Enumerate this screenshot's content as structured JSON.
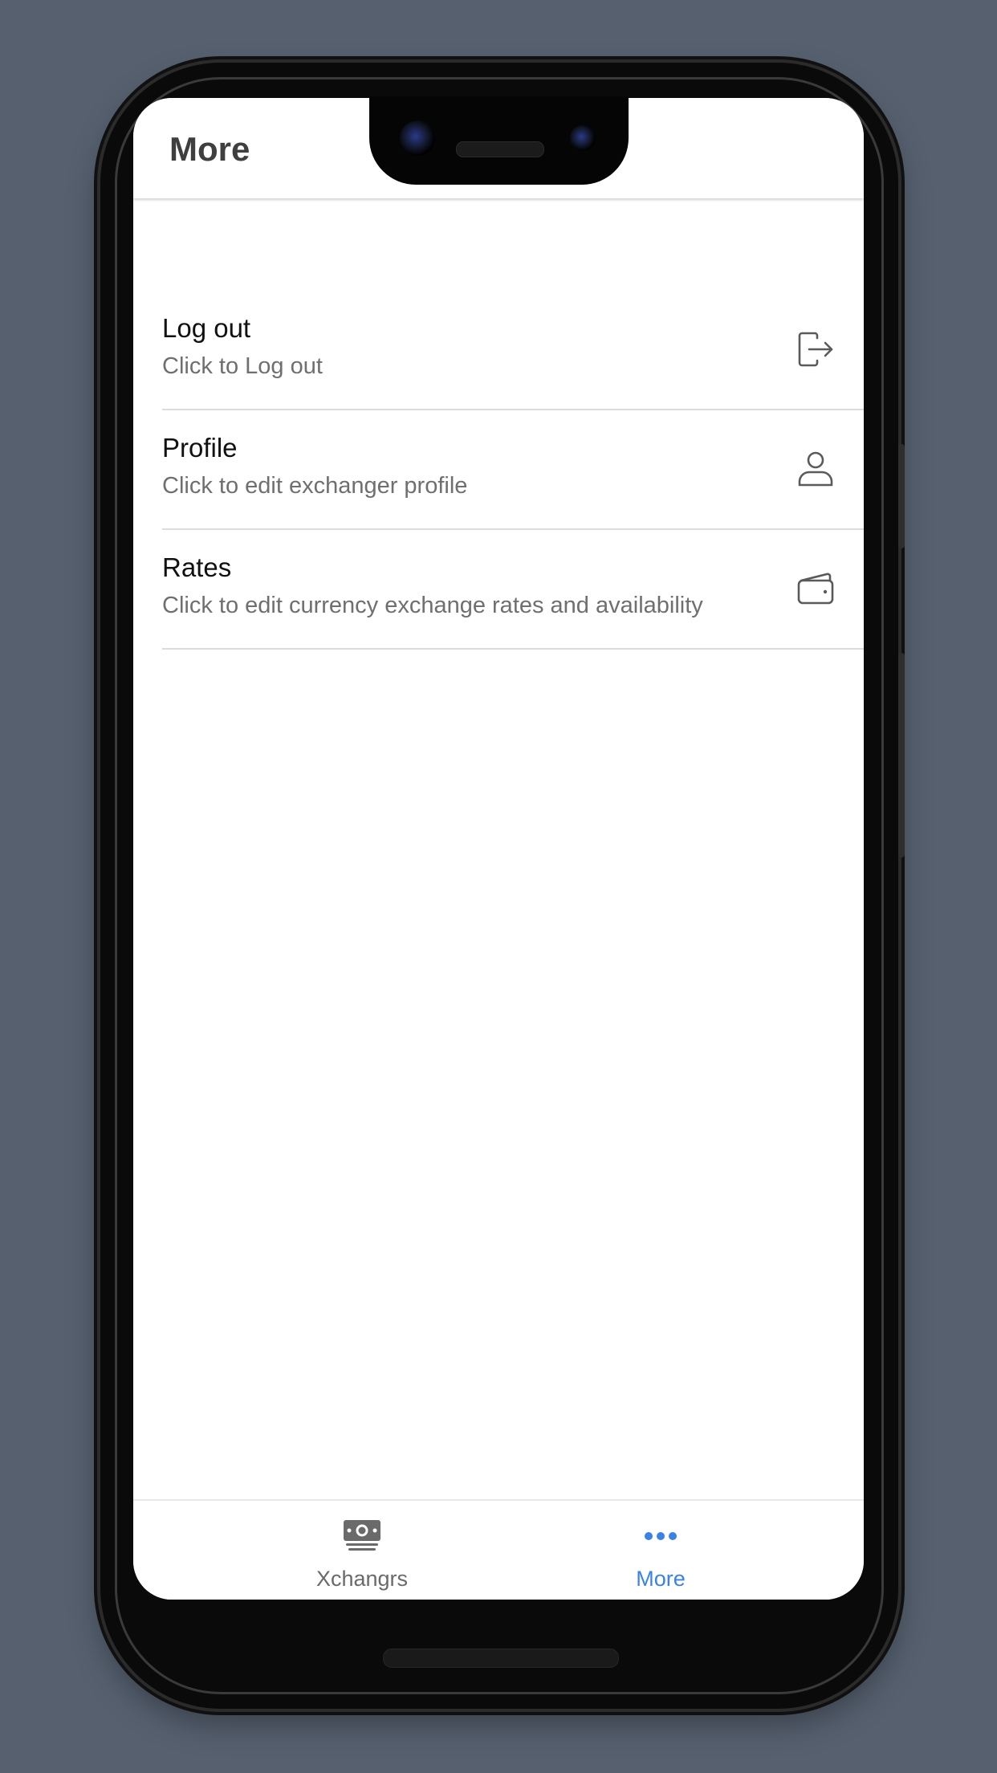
{
  "header": {
    "title": "More"
  },
  "menu": {
    "items": [
      {
        "title": "Log out",
        "subtitle": "Click to Log out",
        "icon": "logout-icon"
      },
      {
        "title": "Profile",
        "subtitle": "Click to edit exchanger profile",
        "icon": "person-icon"
      },
      {
        "title": "Rates",
        "subtitle": "Click to edit currency exchange rates and availability",
        "icon": "wallet-icon"
      }
    ]
  },
  "tabbar": {
    "tabs": [
      {
        "label": "Xchangrs",
        "icon": "money-icon",
        "active": false
      },
      {
        "label": "More",
        "icon": "more-dots-icon",
        "active": true
      }
    ],
    "active_color": "#3b82e6",
    "inactive_color": "#6a6a6a"
  },
  "colors": {
    "background": "#56606f",
    "screen": "#ffffff",
    "divider": "#dcdcdc"
  }
}
